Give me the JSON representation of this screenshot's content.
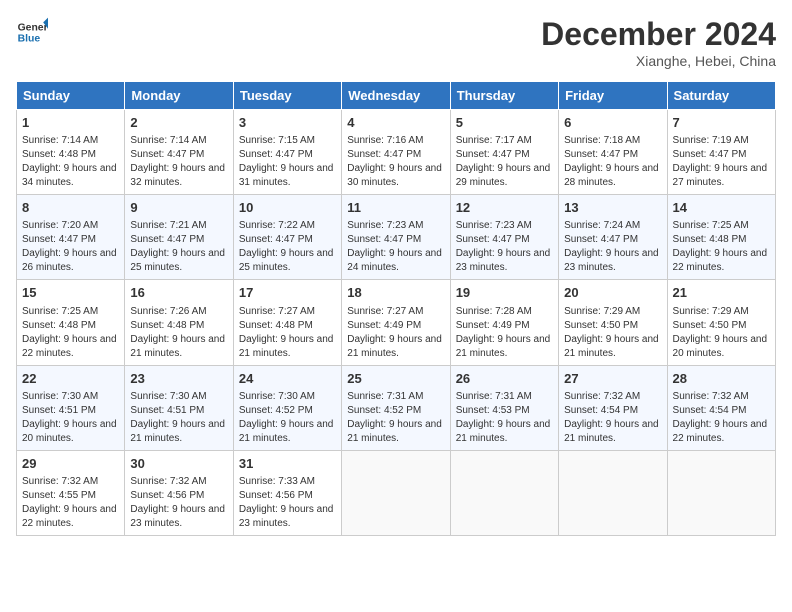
{
  "header": {
    "logo_line1": "General",
    "logo_line2": "Blue",
    "month": "December 2024",
    "location": "Xianghe, Hebei, China"
  },
  "days_of_week": [
    "Sunday",
    "Monday",
    "Tuesday",
    "Wednesday",
    "Thursday",
    "Friday",
    "Saturday"
  ],
  "weeks": [
    [
      {
        "day": "1",
        "sunrise": "7:14 AM",
        "sunset": "4:48 PM",
        "daylight": "9 hours and 34 minutes."
      },
      {
        "day": "2",
        "sunrise": "7:14 AM",
        "sunset": "4:47 PM",
        "daylight": "9 hours and 32 minutes."
      },
      {
        "day": "3",
        "sunrise": "7:15 AM",
        "sunset": "4:47 PM",
        "daylight": "9 hours and 31 minutes."
      },
      {
        "day": "4",
        "sunrise": "7:16 AM",
        "sunset": "4:47 PM",
        "daylight": "9 hours and 30 minutes."
      },
      {
        "day": "5",
        "sunrise": "7:17 AM",
        "sunset": "4:47 PM",
        "daylight": "9 hours and 29 minutes."
      },
      {
        "day": "6",
        "sunrise": "7:18 AM",
        "sunset": "4:47 PM",
        "daylight": "9 hours and 28 minutes."
      },
      {
        "day": "7",
        "sunrise": "7:19 AM",
        "sunset": "4:47 PM",
        "daylight": "9 hours and 27 minutes."
      }
    ],
    [
      {
        "day": "8",
        "sunrise": "7:20 AM",
        "sunset": "4:47 PM",
        "daylight": "9 hours and 26 minutes."
      },
      {
        "day": "9",
        "sunrise": "7:21 AM",
        "sunset": "4:47 PM",
        "daylight": "9 hours and 25 minutes."
      },
      {
        "day": "10",
        "sunrise": "7:22 AM",
        "sunset": "4:47 PM",
        "daylight": "9 hours and 25 minutes."
      },
      {
        "day": "11",
        "sunrise": "7:23 AM",
        "sunset": "4:47 PM",
        "daylight": "9 hours and 24 minutes."
      },
      {
        "day": "12",
        "sunrise": "7:23 AM",
        "sunset": "4:47 PM",
        "daylight": "9 hours and 23 minutes."
      },
      {
        "day": "13",
        "sunrise": "7:24 AM",
        "sunset": "4:47 PM",
        "daylight": "9 hours and 23 minutes."
      },
      {
        "day": "14",
        "sunrise": "7:25 AM",
        "sunset": "4:48 PM",
        "daylight": "9 hours and 22 minutes."
      }
    ],
    [
      {
        "day": "15",
        "sunrise": "7:25 AM",
        "sunset": "4:48 PM",
        "daylight": "9 hours and 22 minutes."
      },
      {
        "day": "16",
        "sunrise": "7:26 AM",
        "sunset": "4:48 PM",
        "daylight": "9 hours and 21 minutes."
      },
      {
        "day": "17",
        "sunrise": "7:27 AM",
        "sunset": "4:48 PM",
        "daylight": "9 hours and 21 minutes."
      },
      {
        "day": "18",
        "sunrise": "7:27 AM",
        "sunset": "4:49 PM",
        "daylight": "9 hours and 21 minutes."
      },
      {
        "day": "19",
        "sunrise": "7:28 AM",
        "sunset": "4:49 PM",
        "daylight": "9 hours and 21 minutes."
      },
      {
        "day": "20",
        "sunrise": "7:29 AM",
        "sunset": "4:50 PM",
        "daylight": "9 hours and 21 minutes."
      },
      {
        "day": "21",
        "sunrise": "7:29 AM",
        "sunset": "4:50 PM",
        "daylight": "9 hours and 20 minutes."
      }
    ],
    [
      {
        "day": "22",
        "sunrise": "7:30 AM",
        "sunset": "4:51 PM",
        "daylight": "9 hours and 20 minutes."
      },
      {
        "day": "23",
        "sunrise": "7:30 AM",
        "sunset": "4:51 PM",
        "daylight": "9 hours and 21 minutes."
      },
      {
        "day": "24",
        "sunrise": "7:30 AM",
        "sunset": "4:52 PM",
        "daylight": "9 hours and 21 minutes."
      },
      {
        "day": "25",
        "sunrise": "7:31 AM",
        "sunset": "4:52 PM",
        "daylight": "9 hours and 21 minutes."
      },
      {
        "day": "26",
        "sunrise": "7:31 AM",
        "sunset": "4:53 PM",
        "daylight": "9 hours and 21 minutes."
      },
      {
        "day": "27",
        "sunrise": "7:32 AM",
        "sunset": "4:54 PM",
        "daylight": "9 hours and 21 minutes."
      },
      {
        "day": "28",
        "sunrise": "7:32 AM",
        "sunset": "4:54 PM",
        "daylight": "9 hours and 22 minutes."
      }
    ],
    [
      {
        "day": "29",
        "sunrise": "7:32 AM",
        "sunset": "4:55 PM",
        "daylight": "9 hours and 22 minutes."
      },
      {
        "day": "30",
        "sunrise": "7:32 AM",
        "sunset": "4:56 PM",
        "daylight": "9 hours and 23 minutes."
      },
      {
        "day": "31",
        "sunrise": "7:33 AM",
        "sunset": "4:56 PM",
        "daylight": "9 hours and 23 minutes."
      },
      null,
      null,
      null,
      null
    ]
  ]
}
